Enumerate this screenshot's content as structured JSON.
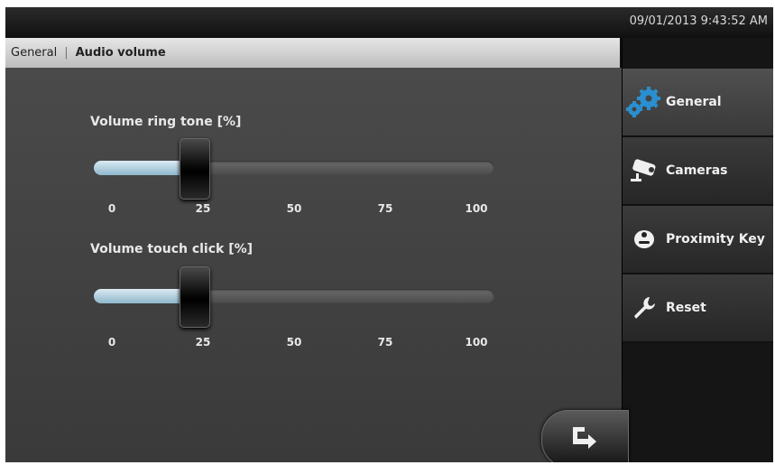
{
  "header": {
    "datetime": "09/01/2013 9:43:52 AM"
  },
  "breadcrumb": {
    "parent": "General",
    "separator": "|",
    "current": "Audio volume"
  },
  "sliders": [
    {
      "title": "Volume ring tone [%]",
      "value": 25,
      "ticks": [
        "0",
        "25",
        "50",
        "75",
        "100"
      ]
    },
    {
      "title": "Volume touch click [%]",
      "value": 25,
      "ticks": [
        "0",
        "25",
        "50",
        "75",
        "100"
      ]
    }
  ],
  "sidebar": {
    "items": [
      {
        "label": "General",
        "icon": "gears-icon",
        "active": true
      },
      {
        "label": "Cameras",
        "icon": "camera-icon",
        "active": false
      },
      {
        "label": "Proximity Key",
        "icon": "proximity-key-icon",
        "active": false
      },
      {
        "label": "Reset",
        "icon": "wrench-icon",
        "active": false
      }
    ]
  },
  "back_button": {
    "icon": "exit-arrow-icon"
  },
  "colors": {
    "accent_blue": "#2a8fd0",
    "track_fill": "#a8cadb"
  }
}
